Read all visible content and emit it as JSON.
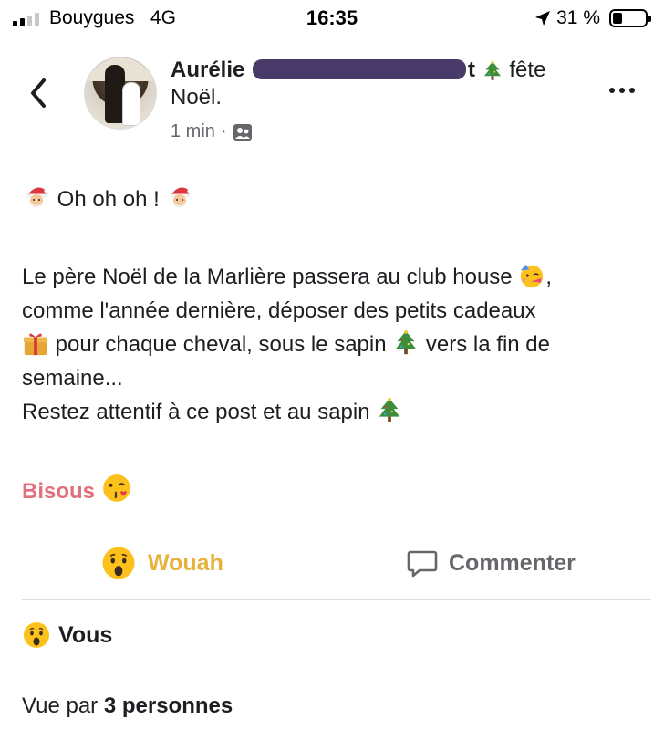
{
  "status_bar": {
    "carrier": "Bouygues",
    "network": "4G",
    "time": "16:35",
    "battery": "31 %"
  },
  "post": {
    "author": "Aurélie",
    "author_suffix": "t",
    "activity": "fête Noël.",
    "time_ago": "1 min",
    "separator": "·",
    "lines": {
      "greeting": "Oh oh oh !",
      "l1": "Le père Noël de la Marlière passera au club house",
      "l2": "comme l'année dernière, déposer des petits cadeaux",
      "l3": "pour chaque cheval, sous le sapin",
      "l3b": "vers la fin de",
      "l4": "semaine...",
      "l5": "Restez attentif à ce post et au sapin"
    },
    "closing": "Bisous"
  },
  "actions": {
    "reaction_label": "Wouah",
    "comment_label": "Commenter"
  },
  "reactions": {
    "by": "Vous"
  },
  "views": {
    "prefix": "Vue par",
    "count_text": "3 personnes"
  },
  "icons": {
    "back": "chevron-left-icon",
    "more": "more-options-icon",
    "audience": "friends-audience-icon",
    "comment": "comment-bubble-icon",
    "location": "location-arrow-icon"
  },
  "colors": {
    "reaction": "#e8b23a",
    "bisous": "#e0707c",
    "muted": "#65676b"
  }
}
